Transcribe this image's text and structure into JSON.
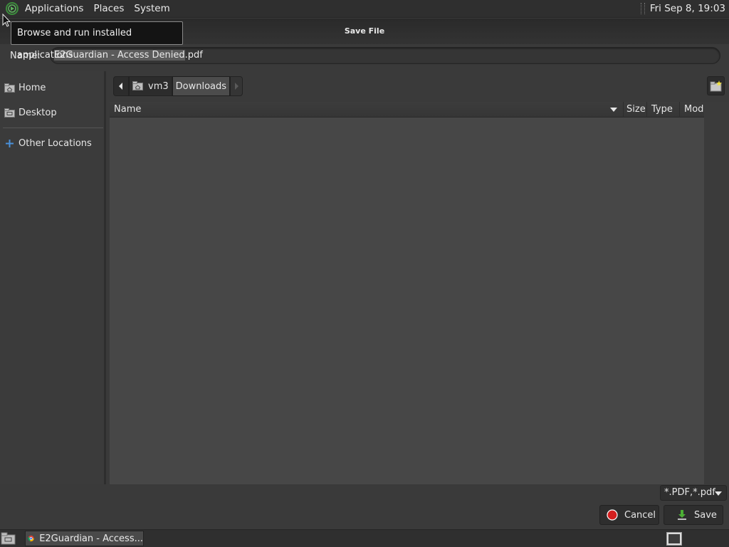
{
  "panel": {
    "menus": [
      "Applications",
      "Places",
      "System"
    ],
    "clock": "Fri Sep  8, 19:03"
  },
  "tooltip": "Browse and run installed applications",
  "dialog": {
    "title": "Save File",
    "name_label": "Name:",
    "filename_base": "E2Guardian - Access Denied",
    "filename_ext": ".pdf"
  },
  "sidebar": {
    "items": [
      {
        "label": "Home",
        "icon": "home-folder-icon"
      },
      {
        "label": "Desktop",
        "icon": "desktop-folder-icon"
      },
      {
        "label": "Other Locations",
        "icon": "plus-icon"
      }
    ]
  },
  "pathbar": {
    "segments": [
      "vm3",
      "Downloads"
    ]
  },
  "columns": [
    "Name",
    "Size",
    "Type",
    "Modif"
  ],
  "filter": "*.PDF,*.pdf",
  "buttons": {
    "cancel": "Cancel",
    "save": "Save"
  },
  "taskbar": {
    "window_title": "E2Guardian - Access..."
  },
  "colors": {
    "cancel_icon": "#d41f1f",
    "save_icon": "#4caf35",
    "other_locations_icon": "#4a90d9"
  }
}
